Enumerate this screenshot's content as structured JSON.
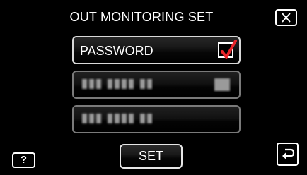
{
  "header": {
    "title": "OUT MONITORING SET",
    "close_icon": "close-icon"
  },
  "settings": {
    "password_row": {
      "label": "PASSWORD",
      "checked": true,
      "check_color": "#e8262b"
    },
    "field_rows": [
      {
        "obscured": true
      },
      {
        "obscured": true
      }
    ]
  },
  "footer": {
    "help_label": "?",
    "set_label": "SET",
    "back_icon": "return-icon"
  }
}
